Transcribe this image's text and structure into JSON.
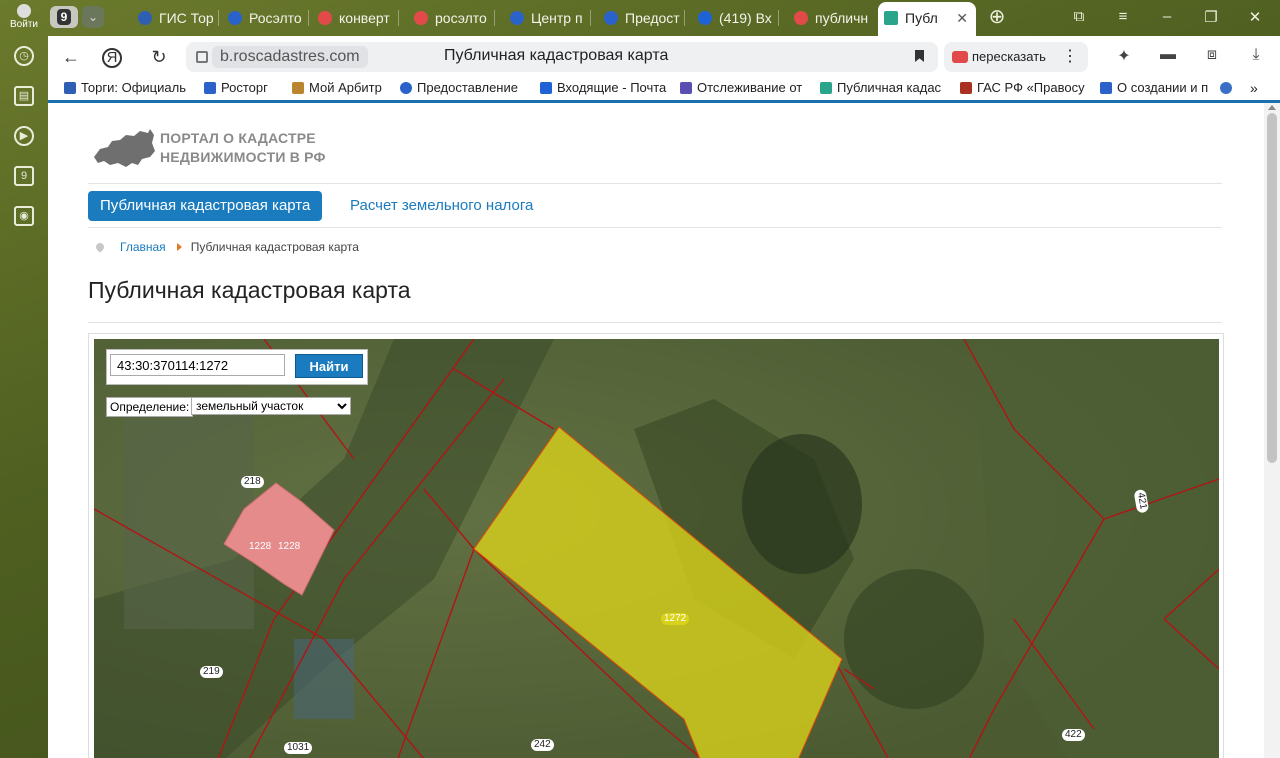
{
  "sidebar": {
    "signin_label": "Войти",
    "icons": [
      "clock-icon",
      "collections-icon",
      "play-icon",
      "badge-9-icon",
      "camera-icon"
    ],
    "badge": "9"
  },
  "tabbar": {
    "tab_count": "9",
    "tabs": [
      {
        "label": "ГИС Тор",
        "color": "#2f5fb3"
      },
      {
        "label": "Росэлто",
        "color": "#2a62c9"
      },
      {
        "label": "конверт",
        "color": "#e24a4a"
      },
      {
        "label": "росэлто",
        "color": "#e24a4a"
      },
      {
        "label": "Центр п",
        "color": "#2a62c9"
      },
      {
        "label": "Предост",
        "color": "#2a62c9"
      },
      {
        "label": "(419) Вх",
        "color": "#1e63d6"
      },
      {
        "label": "публичн",
        "color": "#e24a4a"
      },
      {
        "label": "Публ",
        "color": "#2aa58b"
      }
    ]
  },
  "chrome": {
    "host": "b.roscadastres.com",
    "page_title": "Публичная кадастровая карта",
    "retell_label": "пересказать"
  },
  "bookmarks": [
    {
      "label": "Торги: Официаль",
      "color": "#2f5fb3"
    },
    {
      "label": "Росторг",
      "color": "#2a62c9"
    },
    {
      "label": "Мой Арбитр",
      "color": "#b8862e"
    },
    {
      "label": "Предоставление",
      "color": "#2a62c9"
    },
    {
      "label": "Входящие - Почта",
      "color": "#1e63d6"
    },
    {
      "label": "Отслеживание от",
      "color": "#5a4fb3"
    },
    {
      "label": "Публичная кадас",
      "color": "#2aa58b"
    },
    {
      "label": "ГАС РФ «Правосу",
      "color": "#a8321f"
    },
    {
      "label": "О создании и п",
      "color": "#2a62c9"
    }
  ],
  "page": {
    "portal_line1": "ПОРТАЛ О КАДАСТРЕ",
    "portal_line2": "НЕДВИЖИМОСТИ В РФ",
    "nav_active": "Публичная кадастровая карта",
    "nav_link": "Расчет земельного налога",
    "breadcrumb_home": "Главная",
    "breadcrumb_current": "Публичная кадастровая карта",
    "heading": "Публичная кадастровая карта"
  },
  "map": {
    "search_value": "43:30:370114:1272",
    "search_button": "Найти",
    "definition_label": "Определение:",
    "definition_selected": "земельный участок",
    "parcel_labels": [
      "218",
      "1228",
      "1228",
      "1272",
      "219",
      "1031",
      "242",
      "422",
      "421"
    ],
    "highlight_color": "#d8d21a",
    "building_color": "#e58b8b",
    "boundary_color": "#b01515"
  }
}
